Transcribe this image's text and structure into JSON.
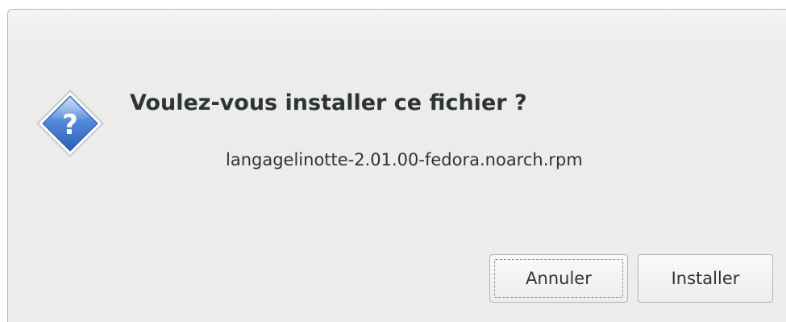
{
  "dialog": {
    "icon": "question-icon",
    "title": "Voulez-vous installer ce fichier ?",
    "message": "langagelinotte-2.01.00-fedora.noarch.rpm",
    "buttons": {
      "cancel_label": "Annuler",
      "install_label": "Installer"
    },
    "colors": {
      "icon_fill": "#4a7fcf",
      "icon_border": "#ffffff",
      "text": "#2e3436",
      "background": "#ececeb"
    }
  }
}
